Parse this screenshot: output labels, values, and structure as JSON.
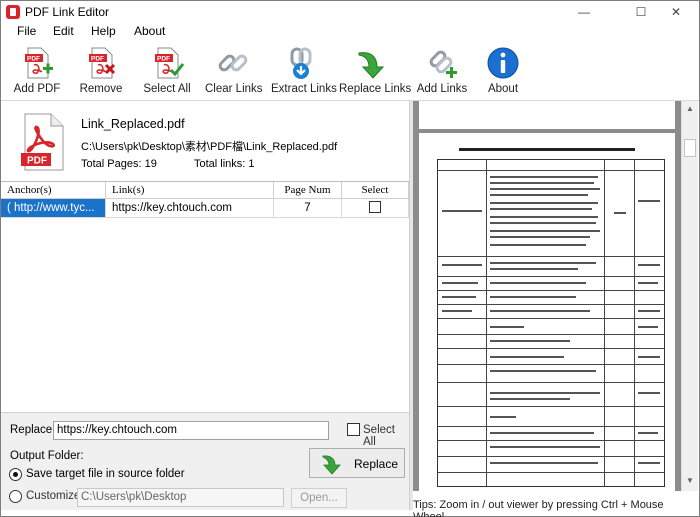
{
  "window": {
    "title": "PDF Link Editor",
    "controls": {
      "minimize": "—",
      "maximize": "☐",
      "close": "✕"
    }
  },
  "menu": [
    "File",
    "Edit",
    "Help",
    "About"
  ],
  "toolbar": [
    {
      "label": "Add PDF",
      "icon": "add-pdf-icon"
    },
    {
      "label": "Remove",
      "icon": "remove-pdf-icon"
    },
    {
      "label": "Select All",
      "icon": "select-all-icon"
    },
    {
      "label": "Clear Links",
      "icon": "broken-link-icon"
    },
    {
      "label": "Extract Links",
      "icon": "extract-links-icon"
    },
    {
      "label": "Replace Links",
      "icon": "replace-arrow-icon"
    },
    {
      "label": "Add Links",
      "icon": "add-link-icon"
    },
    {
      "label": "About",
      "icon": "info-icon"
    }
  ],
  "file": {
    "name": "Link_Replaced.pdf",
    "path": "C:\\Users\\pk\\Desktop\\素材\\PDF檔\\Link_Replaced.pdf",
    "pages_text": "Total Pages: 19",
    "links_text": "Total links: 1"
  },
  "grid": {
    "headers": [
      "Anchor(s)",
      "Link(s)",
      "Page Num",
      "Select"
    ],
    "rows": [
      {
        "anchor": "( http://www.tyc...",
        "link": "https://key.chtouch.com",
        "page": "7",
        "select": false
      }
    ]
  },
  "replace": {
    "label": "Replace:",
    "value": "https://key.chtouch.com",
    "select_all_label": "Select All",
    "button_label": "Replace"
  },
  "output": {
    "label": "Output Folder:",
    "option_source": "Save target file in source folder",
    "option_custom": "Customize:",
    "custom_path": "C:\\Users\\pk\\Desktop",
    "open_label": "Open...",
    "selected": "source"
  },
  "viewer": {
    "tips": "Tips: Zoom in / out viewer by pressing Ctrl + Mouse Wheel."
  },
  "colors": {
    "selection": "#1a73c9",
    "viewer_bg": "#8c8c8c",
    "accent_red": "#d8242b"
  }
}
